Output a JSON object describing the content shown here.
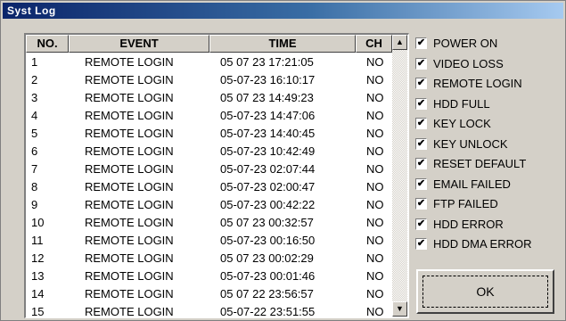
{
  "window": {
    "title": "Syst Log"
  },
  "columns": {
    "no": "NO.",
    "event": "EVENT",
    "time": "TIME",
    "ch": "CH"
  },
  "rows": [
    {
      "no": "1",
      "event": "REMOTE LOGIN",
      "time": "05 07 23 17:21:05",
      "ch": "NO"
    },
    {
      "no": "2",
      "event": "REMOTE LOGIN",
      "time": "05-07-23 16:10:17",
      "ch": "NO"
    },
    {
      "no": "3",
      "event": "REMOTE LOGIN",
      "time": "05 07 23 14:49:23",
      "ch": "NO"
    },
    {
      "no": "4",
      "event": "REMOTE LOGIN",
      "time": "05-07-23 14:47:06",
      "ch": "NO"
    },
    {
      "no": "5",
      "event": "REMOTE LOGIN",
      "time": "05-07-23 14:40:45",
      "ch": "NO"
    },
    {
      "no": "6",
      "event": "REMOTE LOGIN",
      "time": "05-07-23 10:42:49",
      "ch": "NO"
    },
    {
      "no": "7",
      "event": "REMOTE LOGIN",
      "time": "05-07-23 02:07:44",
      "ch": "NO"
    },
    {
      "no": "8",
      "event": "REMOTE LOGIN",
      "time": "05-07-23 02:00:47",
      "ch": "NO"
    },
    {
      "no": "9",
      "event": "REMOTE LOGIN",
      "time": "05-07-23 00:42:22",
      "ch": "NO"
    },
    {
      "no": "10",
      "event": "REMOTE LOGIN",
      "time": "05 07 23 00:32:57",
      "ch": "NO"
    },
    {
      "no": "11",
      "event": "REMOTE LOGIN",
      "time": "05-07-23 00:16:50",
      "ch": "NO"
    },
    {
      "no": "12",
      "event": "REMOTE LOGIN",
      "time": "05 07 23 00:02:29",
      "ch": "NO"
    },
    {
      "no": "13",
      "event": "REMOTE LOGIN",
      "time": "05-07-23 00:01:46",
      "ch": "NO"
    },
    {
      "no": "14",
      "event": "REMOTE LOGIN",
      "time": "05 07 22 23:56:57",
      "ch": "NO"
    },
    {
      "no": "15",
      "event": "REMOTE LOGIN",
      "time": "05-07-22 23:51:55",
      "ch": "NO"
    }
  ],
  "filters": [
    {
      "label": "POWER ON",
      "checked": true
    },
    {
      "label": "VIDEO LOSS",
      "checked": true
    },
    {
      "label": "REMOTE LOGIN",
      "checked": true
    },
    {
      "label": "HDD FULL",
      "checked": true
    },
    {
      "label": "KEY LOCK",
      "checked": true
    },
    {
      "label": "KEY UNLOCK",
      "checked": true
    },
    {
      "label": "RESET DEFAULT",
      "checked": true
    },
    {
      "label": "EMAIL FAILED",
      "checked": true
    },
    {
      "label": "FTP FAILED",
      "checked": true
    },
    {
      "label": "HDD ERROR",
      "checked": true
    },
    {
      "label": "HDD DMA ERROR",
      "checked": true
    }
  ],
  "ok_label": "OK",
  "scroll_up": "▲",
  "scroll_down": "▼",
  "check_mark": "✔"
}
